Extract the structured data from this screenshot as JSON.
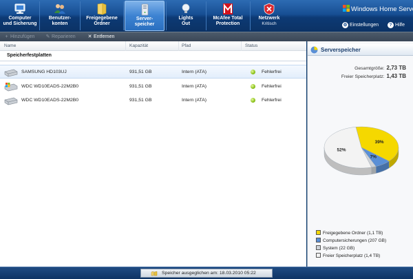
{
  "nav": {
    "items": [
      {
        "label": "Computer\nund Sicherung",
        "sub": "",
        "icon": "computer-backup-icon"
      },
      {
        "label": "Benutzer-\nkonten",
        "sub": "",
        "icon": "users-icon"
      },
      {
        "label": "Freigegebene\nOrdner",
        "sub": "",
        "icon": "shared-folders-icon"
      },
      {
        "label": "Server-\nspeicher",
        "sub": "",
        "icon": "server-storage-icon"
      },
      {
        "label": "Lights\nOut",
        "sub": "",
        "icon": "lightbulb-icon"
      },
      {
        "label": "McAfee Total\nProtection",
        "sub": "",
        "icon": "mcafee-icon"
      },
      {
        "label": "Netzwerk",
        "sub": "Kritisch",
        "icon": "network-critical-icon"
      }
    ],
    "active_index": 3
  },
  "brand": {
    "text": "Windows Home Server"
  },
  "top_links": {
    "settings": "Einstellungen",
    "help": "Hilfe"
  },
  "toolbar": {
    "add": "Hinzufügen",
    "repair": "Reparieren",
    "remove": "Entfernen"
  },
  "columns": {
    "name": "Name",
    "capacity": "Kapazität",
    "path": "Pfad",
    "status": "Status"
  },
  "group_title": "Speicherfestplatten",
  "disks": [
    {
      "name": "SAMSUNG HD103UJ",
      "capacity": "931,51 GB",
      "path": "Intern (ATA)",
      "status": "Fehlerfrei",
      "selected": true,
      "icon": "hard-disk-icon"
    },
    {
      "name": "WDC WD10EADS-22M2B0",
      "capacity": "931,51 GB",
      "path": "Intern (ATA)",
      "status": "Fehlerfrei",
      "selected": false,
      "icon": "system-disk-icon"
    },
    {
      "name": "WDC WD10EADS-22M2B0",
      "capacity": "931,51 GB",
      "path": "Intern (ATA)",
      "status": "Fehlerfrei",
      "selected": false,
      "icon": "hard-disk-icon"
    }
  ],
  "side": {
    "title": "Serverspeicher",
    "total_label": "Gesamtgröße:",
    "total_value": "2,73 TB",
    "free_label": "Freier Speicherplatz:",
    "free_value": "1,43 TB"
  },
  "chart_data": {
    "type": "pie",
    "slices": [
      {
        "name": "Freigegebene Ordner (1,1 TB)",
        "value": 39,
        "label": "39%",
        "color": "#f5d800"
      },
      {
        "name": "Computersicherungen (207 GB)",
        "value": 7,
        "label": "7%",
        "color": "#5a8fd6"
      },
      {
        "name": "System (22 GB)",
        "value": 2,
        "label": "",
        "color": "#cfd3d8"
      },
      {
        "name": "Freier Speicherplatz (1,4 TB)",
        "value": 52,
        "label": "52%",
        "color": "#f3f3f3"
      }
    ]
  },
  "status_bar": {
    "message": "Speicher ausgeglichen am: 18.03.2010 05:22"
  }
}
